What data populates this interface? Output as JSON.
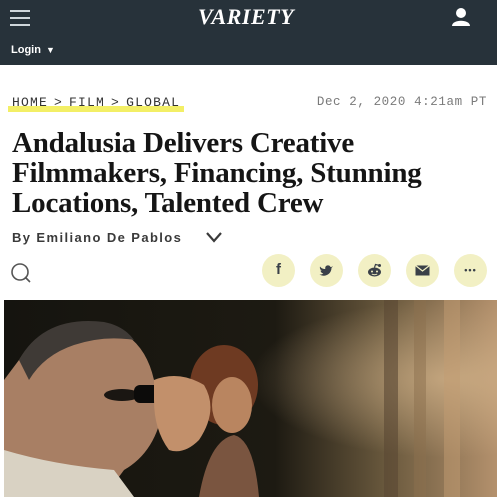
{
  "header": {
    "logo_text": "VARIETY",
    "login_label": "Login",
    "background_color": "#27323a"
  },
  "article": {
    "breadcrumb": [
      "HOME",
      "FILM",
      "GLOBAL"
    ],
    "breadcrumb_separator": ">",
    "date": "Dec 2, 2020 4:21am PT",
    "headline": "Andalusia Delivers Creative Filmmakers, Financing, Stunning Locations, Talented Crew",
    "byline": "By Emiliano De Pablos"
  },
  "share": {
    "facebook_glyph": "f",
    "more_glyph": "•••",
    "button_color": "#f2f0c4"
  },
  "highlight_color": "#f3ef66",
  "icons": [
    "menu-icon",
    "user-icon",
    "caret-down-icon",
    "chevron-down-icon",
    "comment-icon",
    "facebook-icon",
    "twitter-icon",
    "reddit-icon",
    "email-icon",
    "more-icon"
  ]
}
